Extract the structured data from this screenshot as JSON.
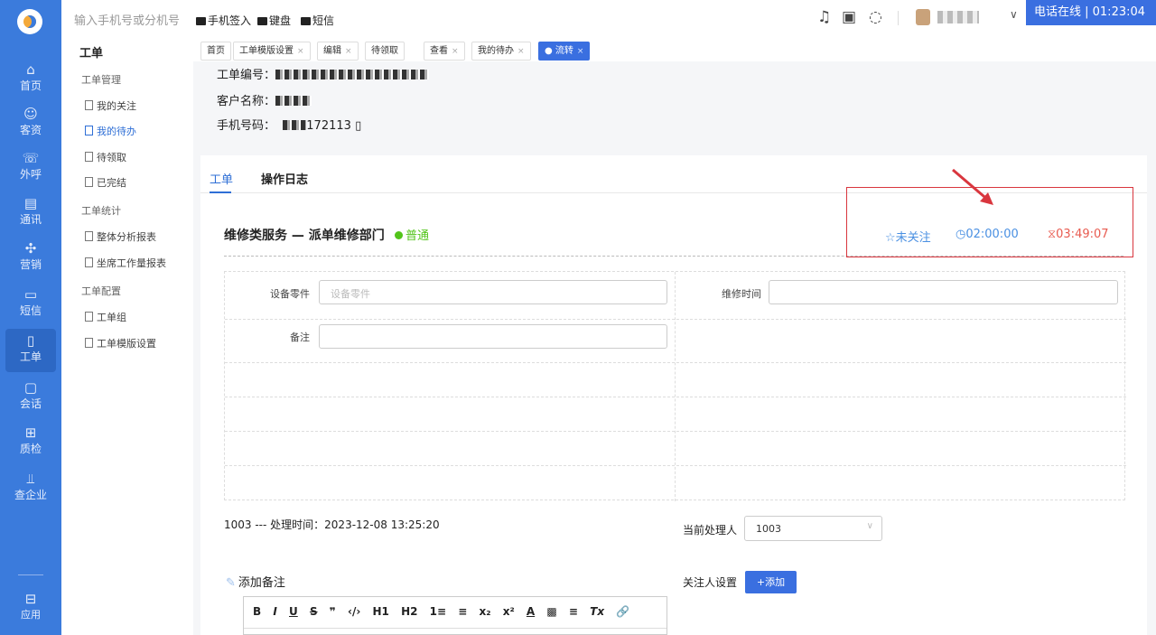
{
  "rail": {
    "items": [
      {
        "label": "首页",
        "icon": "home-icon"
      },
      {
        "label": "客资",
        "icon": "customers-icon"
      },
      {
        "label": "外呼",
        "icon": "phone-icon"
      },
      {
        "label": "通讯",
        "icon": "contacts-icon"
      },
      {
        "label": "营销",
        "icon": "marketing-icon"
      },
      {
        "label": "短信",
        "icon": "sms-icon"
      },
      {
        "label": "工单",
        "icon": "clipboard-icon"
      },
      {
        "label": "会话",
        "icon": "chat-icon"
      },
      {
        "label": "质检",
        "icon": "inspect-icon"
      },
      {
        "label": "查企业",
        "icon": "building-icon"
      },
      {
        "label": "应用",
        "icon": "apps-icon"
      }
    ]
  },
  "subnav": {
    "title": "工单",
    "groups": [
      "工单管理",
      "工单统计",
      "工单配置"
    ],
    "items": [
      "我的关注",
      "我的待办",
      "待领取",
      "已完结",
      "整体分析报表",
      "坐席工作量报表",
      "工单组",
      "工单模版设置"
    ]
  },
  "topbar": {
    "search_placeholder": "输入手机号或分机号",
    "actions": [
      "手机签入",
      "键盘",
      "短信"
    ],
    "status": "电话在线 |  01:23:04"
  },
  "tabs": [
    "首页",
    "工单模版设置",
    "编辑",
    "待领取",
    "查看",
    "我的待办",
    "流转"
  ],
  "info": {
    "order_no_label": "工单编号：",
    "customer_label": "客户名称：",
    "phone_label": "手机号码：",
    "phone_suffix": "172113"
  },
  "card": {
    "tabs": [
      "工单",
      "操作日志"
    ],
    "service_title": "维修类服务 — 派单维修部门",
    "priority": "普通",
    "follow": "未关注",
    "timer": "02:00:00",
    "deadline": "03:49:07",
    "fields": {
      "part_label": "设备零件",
      "part_placeholder": "设备零件",
      "repair_time_label": "维修时间",
      "remark_label": "备注"
    },
    "handler_line": "1003 --- 处理时间：2023-12-08 13:25:20",
    "current_handler_label": "当前处理人",
    "current_handler_value": "1003",
    "add_note": "添加备注",
    "follower_setting": "关注人设置",
    "add_button": "+添加",
    "toolbar": [
      "B",
      "I",
      "U",
      "S",
      "❞",
      "‹/›",
      "H1",
      "H2",
      "1≡",
      "≡",
      "x₂",
      "x²",
      "A",
      "▩",
      "≡",
      "Tx",
      "🔗"
    ]
  },
  "colors": {
    "primary": "#3a6fe0",
    "rail": "#3b7bdc",
    "warning": "#e85b50",
    "success": "#52c41a"
  }
}
